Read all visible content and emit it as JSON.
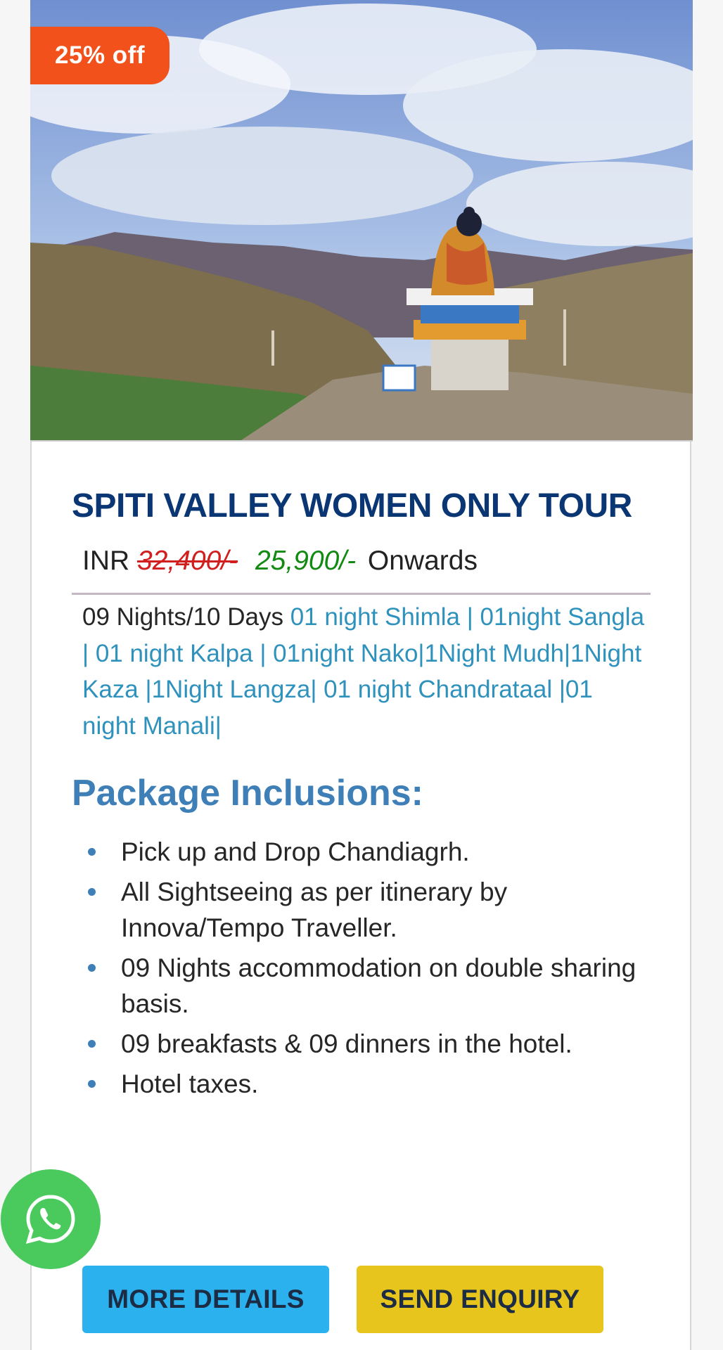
{
  "banner": {
    "discount_label": "25% off",
    "image_icon": "buddha-statue-landscape-photo"
  },
  "package": {
    "title": "SPITI VALLEY WOMEN ONLY TOUR",
    "price": {
      "currency": "INR",
      "old_price": "32,400/-",
      "new_price": "25,900/-",
      "suffix": "Onwards"
    },
    "itinerary": {
      "duration": "09 Nights/10 Days",
      "details": "01 night Shimla | 01night Sangla | 01 night Kalpa | 01night Nako|1Night Mudh|1Night Kaza |1Night Langza| 01 night Chandrataal |01 night Manali|"
    },
    "inclusions": {
      "heading": "Package Inclusions:",
      "items": [
        "Pick up and Drop Chandiagrh.",
        "All Sightseeing as per itinerary by Innova/Tempo Traveller.",
        "09 Nights accommodation on double sharing basis.",
        "09 breakfasts & 09 dinners in the hotel.",
        "Hotel taxes."
      ]
    }
  },
  "actions": {
    "more_details": "MORE DETAILS",
    "send_enquiry": "SEND ENQUIRY"
  },
  "floating": {
    "whatsapp_icon": "whatsapp-icon"
  },
  "colors": {
    "discount_badge": "#f2511b",
    "title": "#0a3674",
    "old_price": "#d11f1f",
    "new_price": "#128a12",
    "itinerary_link": "#2f92bd",
    "inclusions_heading": "#3d7fb6",
    "more_details_button": "#2bb1ee",
    "send_enquiry_button": "#e8c51c",
    "whatsapp": "#4ac95c"
  }
}
